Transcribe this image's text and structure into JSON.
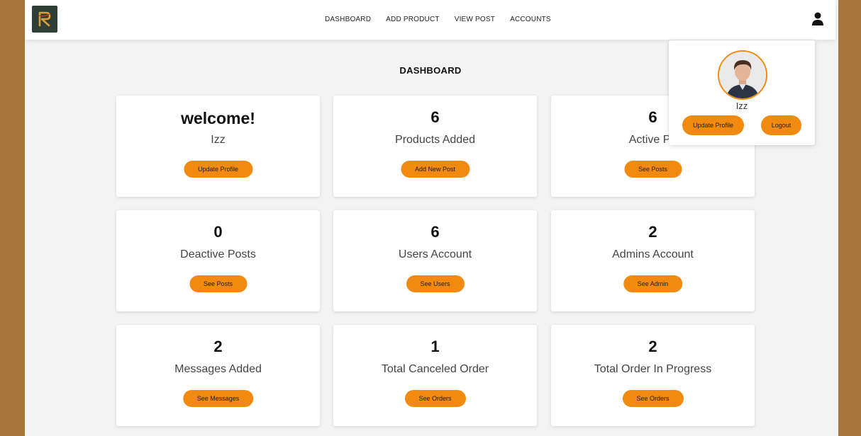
{
  "nav": {
    "links": [
      "DASHBOARD",
      "ADD PRODUCT",
      "VIEW POST",
      "ACCOUNTS"
    ]
  },
  "page_title": "DASHBOARD",
  "cards": [
    {
      "value": "welcome!",
      "label": "Izz",
      "button": "Update Profile"
    },
    {
      "value": "6",
      "label": "Products Added",
      "button": "Add New Post"
    },
    {
      "value": "6",
      "label": "Active Po",
      "button": "See Posts"
    },
    {
      "value": "0",
      "label": "Deactive Posts",
      "button": "See Posts"
    },
    {
      "value": "6",
      "label": "Users Account",
      "button": "See Users"
    },
    {
      "value": "2",
      "label": "Admins Account",
      "button": "See Admin"
    },
    {
      "value": "2",
      "label": "Messages Added",
      "button": "See Messages"
    },
    {
      "value": "1",
      "label": "Total Canceled Order",
      "button": "See Orders"
    },
    {
      "value": "2",
      "label": "Total Order In Progress",
      "button": "See Orders"
    }
  ],
  "profile_popup": {
    "name": "Izz",
    "update_label": "Update Profile",
    "logout_label": "Logout"
  },
  "colors": {
    "accent": "#f28a12",
    "frame": "#a7773a",
    "background": "#f3f3f3"
  },
  "icons": {
    "logo": "brand-logo-icon",
    "user": "user-icon"
  }
}
